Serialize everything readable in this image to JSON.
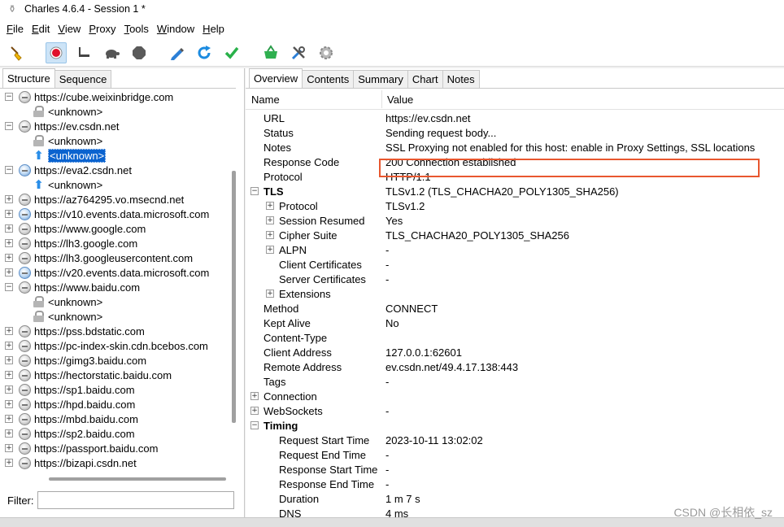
{
  "window": {
    "title": "Charles 4.6.4 - Session 1 *"
  },
  "menu": [
    {
      "mnemonic": "F",
      "rest": "ile"
    },
    {
      "mnemonic": "E",
      "rest": "dit"
    },
    {
      "mnemonic": "V",
      "rest": "iew"
    },
    {
      "mnemonic": "P",
      "rest": "roxy"
    },
    {
      "mnemonic": "T",
      "rest": "ools"
    },
    {
      "mnemonic": "W",
      "rest": "indow"
    },
    {
      "mnemonic": "H",
      "rest": "elp"
    }
  ],
  "toolbar": [
    "broom-icon",
    "record-icon",
    "throttle-icon",
    "turtle-icon",
    "stop-icon",
    "pen-icon",
    "refresh-icon",
    "check-icon",
    "basket-icon",
    "tools-icon",
    "settings-icon"
  ],
  "left_tabs": {
    "structure": "Structure",
    "sequence": "Sequence"
  },
  "tree": [
    {
      "type": "host",
      "label": "https://cube.weixinbridge.com",
      "expanded": true,
      "icon": "lock"
    },
    {
      "type": "child",
      "label": "<unknown>",
      "icon": "lock"
    },
    {
      "type": "host",
      "label": "https://ev.csdn.net",
      "expanded": true,
      "icon": "lock"
    },
    {
      "type": "child",
      "label": "<unknown>",
      "icon": "lock"
    },
    {
      "type": "child",
      "label": "<unknown>",
      "icon": "arrow",
      "selected": true
    },
    {
      "type": "host",
      "label": "https://eva2.csdn.net",
      "expanded": true,
      "icon": "blue"
    },
    {
      "type": "child",
      "label": "<unknown>",
      "icon": "arrow"
    },
    {
      "type": "host",
      "label": "https://az764295.vo.msecnd.net",
      "expanded": false,
      "icon": "lock"
    },
    {
      "type": "host",
      "label": "https://v10.events.data.microsoft.com",
      "expanded": false,
      "icon": "blue"
    },
    {
      "type": "host",
      "label": "https://www.google.com",
      "expanded": false,
      "icon": "lock"
    },
    {
      "type": "host",
      "label": "https://lh3.google.com",
      "expanded": false,
      "icon": "lock"
    },
    {
      "type": "host",
      "label": "https://lh3.googleusercontent.com",
      "expanded": false,
      "icon": "lock"
    },
    {
      "type": "host",
      "label": "https://v20.events.data.microsoft.com",
      "expanded": false,
      "icon": "blue"
    },
    {
      "type": "host",
      "label": "https://www.baidu.com",
      "expanded": true,
      "icon": "lock"
    },
    {
      "type": "child",
      "label": "<unknown>",
      "icon": "lock"
    },
    {
      "type": "child",
      "label": "<unknown>",
      "icon": "lock"
    },
    {
      "type": "host",
      "label": "https://pss.bdstatic.com",
      "expanded": false,
      "icon": "lock"
    },
    {
      "type": "host",
      "label": "https://pc-index-skin.cdn.bcebos.com",
      "expanded": false,
      "icon": "lock"
    },
    {
      "type": "host",
      "label": "https://gimg3.baidu.com",
      "expanded": false,
      "icon": "lock"
    },
    {
      "type": "host",
      "label": "https://hectorstatic.baidu.com",
      "expanded": false,
      "icon": "lock"
    },
    {
      "type": "host",
      "label": "https://sp1.baidu.com",
      "expanded": false,
      "icon": "lock"
    },
    {
      "type": "host",
      "label": "https://hpd.baidu.com",
      "expanded": false,
      "icon": "lock"
    },
    {
      "type": "host",
      "label": "https://mbd.baidu.com",
      "expanded": false,
      "icon": "lock"
    },
    {
      "type": "host",
      "label": "https://sp2.baidu.com",
      "expanded": false,
      "icon": "lock"
    },
    {
      "type": "host",
      "label": "https://passport.baidu.com",
      "expanded": false,
      "icon": "lock"
    },
    {
      "type": "host",
      "label": "https://bizapi.csdn.net",
      "expanded": false,
      "icon": "lock"
    }
  ],
  "filter": {
    "label": "Filter:",
    "value": ""
  },
  "right_tabs": [
    "Overview",
    "Contents",
    "Summary",
    "Chart",
    "Notes"
  ],
  "columns": {
    "name": "Name",
    "value": "Value"
  },
  "rows": [
    {
      "name": "URL",
      "value": "https://ev.csdn.net",
      "level": 0
    },
    {
      "name": "Status",
      "value": "Sending request body...",
      "level": 0
    },
    {
      "name": "Notes",
      "value": "SSL Proxying not enabled for this host: enable in Proxy Settings, SSL locations",
      "level": 0,
      "highlight": true
    },
    {
      "name": "Response Code",
      "value": "200 Connection established",
      "level": 0
    },
    {
      "name": "Protocol",
      "value": "HTTP/1.1",
      "level": 0
    },
    {
      "name": "TLS",
      "value": "TLSv1.2 (TLS_CHACHA20_POLY1305_SHA256)",
      "level": 0,
      "group": "expanded",
      "bold": true
    },
    {
      "name": "Protocol",
      "value": "TLSv1.2",
      "level": 1,
      "group": "collapsed"
    },
    {
      "name": "Session Resumed",
      "value": "Yes",
      "level": 1,
      "group": "collapsed"
    },
    {
      "name": "Cipher Suite",
      "value": "TLS_CHACHA20_POLY1305_SHA256",
      "level": 1,
      "group": "collapsed"
    },
    {
      "name": "ALPN",
      "value": "-",
      "level": 1,
      "group": "collapsed"
    },
    {
      "name": "Client Certificates",
      "value": "-",
      "level": 1
    },
    {
      "name": "Server Certificates",
      "value": "-",
      "level": 1
    },
    {
      "name": "Extensions",
      "value": "",
      "level": 1,
      "group": "collapsed"
    },
    {
      "name": "Method",
      "value": "CONNECT",
      "level": 0
    },
    {
      "name": "Kept Alive",
      "value": "No",
      "level": 0
    },
    {
      "name": "Content-Type",
      "value": "",
      "level": 0
    },
    {
      "name": "Client Address",
      "value": "127.0.0.1:62601",
      "level": 0
    },
    {
      "name": "Remote Address",
      "value": "ev.csdn.net/49.4.17.138:443",
      "level": 0
    },
    {
      "name": "Tags",
      "value": "-",
      "level": 0
    },
    {
      "name": "Connection",
      "value": "",
      "level": 0,
      "group": "collapsed"
    },
    {
      "name": "WebSockets",
      "value": "-",
      "level": 0,
      "group": "collapsed"
    },
    {
      "name": "Timing",
      "value": "",
      "level": 0,
      "group": "expanded",
      "bold": true
    },
    {
      "name": "Request Start Time",
      "value": "2023-10-11 13:02:02",
      "level": 1
    },
    {
      "name": "Request End Time",
      "value": "-",
      "level": 1
    },
    {
      "name": "Response Start Time",
      "value": "-",
      "level": 1
    },
    {
      "name": "Response End Time",
      "value": "-",
      "level": 1
    },
    {
      "name": "Duration",
      "value": "1 m 7 s",
      "level": 1
    },
    {
      "name": "DNS",
      "value": "4 ms",
      "level": 1
    }
  ],
  "watermark": "CSDN @长相依_sz"
}
